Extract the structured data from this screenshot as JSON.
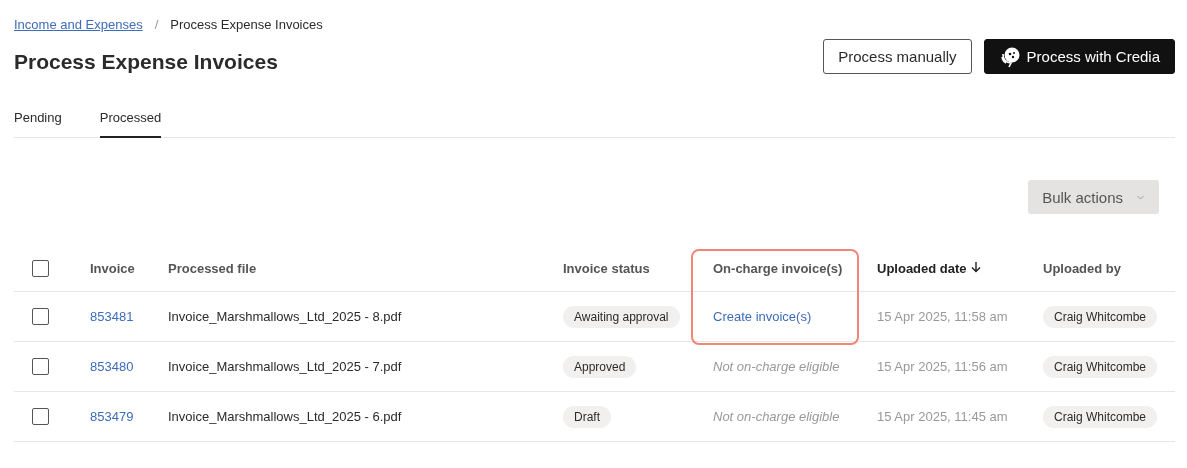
{
  "breadcrumb": {
    "link": "Income and Expenses",
    "separator": "/",
    "current": "Process Expense Invoices"
  },
  "title": "Process Expense Invoices",
  "actions": [
    {
      "label": "Process manually",
      "kind": "secondary"
    },
    {
      "label": "Process with Credia",
      "kind": "primary"
    }
  ],
  "tabs": [
    {
      "label": "Pending",
      "selected": false
    },
    {
      "label": "Processed",
      "selected": true
    }
  ],
  "bulk_actions": {
    "label": "Bulk actions",
    "disabled": true
  },
  "table": {
    "select_all": {
      "checked": false
    },
    "columns": [
      {
        "label": "Invoice",
        "sorted": false,
        "highlighted": false
      },
      {
        "label": "Processed file",
        "sorted": false,
        "highlighted": false
      },
      {
        "label": "Invoice status",
        "sorted": false,
        "highlighted": false
      },
      {
        "label": "On-charge invoice(s)",
        "sorted": false,
        "highlighted": true
      },
      {
        "label": "Uploaded date",
        "sorted": true,
        "highlighted": false
      },
      {
        "label": "Uploaded by",
        "sorted": false,
        "highlighted": false
      }
    ],
    "rows": [
      {
        "checked": false,
        "invoice": "853481",
        "file": "Invoice_Marshmallows_Ltd_2025 - 8.pdf",
        "status": "Awaiting approval",
        "on_charge": {
          "kind": "link",
          "text": "Create invoice(s)"
        },
        "uploaded_date": "15 Apr 2025, 11:58 am",
        "uploaded_by": "Craig Whitcombe"
      },
      {
        "checked": false,
        "invoice": "853480",
        "file": "Invoice_Marshmallows_Ltd_2025 - 7.pdf",
        "status": "Approved",
        "on_charge": {
          "kind": "note",
          "text": "Not on-charge eligible"
        },
        "uploaded_date": "15 Apr 2025, 11:56 am",
        "uploaded_by": "Craig Whitcombe"
      },
      {
        "checked": false,
        "invoice": "853479",
        "file": "Invoice_Marshmallows_Ltd_2025 - 6.pdf",
        "status": "Draft",
        "on_charge": {
          "kind": "note",
          "text": "Not on-charge eligible"
        },
        "uploaded_date": "15 Apr 2025, 11:45 am",
        "uploaded_by": "Craig Whitcombe"
      }
    ]
  }
}
